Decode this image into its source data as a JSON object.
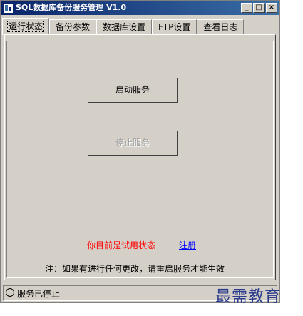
{
  "window": {
    "title": "SQL数据库备份服务管理 V1.0",
    "controls": {
      "minimize": "_",
      "maximize": "□",
      "close": "×"
    }
  },
  "tabs": [
    {
      "label": "运行状态",
      "active": true
    },
    {
      "label": "备份参数",
      "active": false
    },
    {
      "label": "数据库设置",
      "active": false
    },
    {
      "label": "FTP设置",
      "active": false
    },
    {
      "label": "查看日志",
      "active": false
    }
  ],
  "main": {
    "start_button": "启动服务",
    "stop_button": "停止服务",
    "trial_status": "你目前是试用状态",
    "register_link": "注册",
    "note": "注：如果有进行任何更改，请重启服务才能生效"
  },
  "statusbar": {
    "text": "服务已停止",
    "icon": "circle-icon"
  },
  "watermark": "最需教育",
  "colors": {
    "titlebar_start": "#0a246a",
    "titlebar_end": "#3a6ea5",
    "window_bg": "#d4d0c8",
    "trial_text": "#ff0000",
    "link": "#0000ff"
  }
}
